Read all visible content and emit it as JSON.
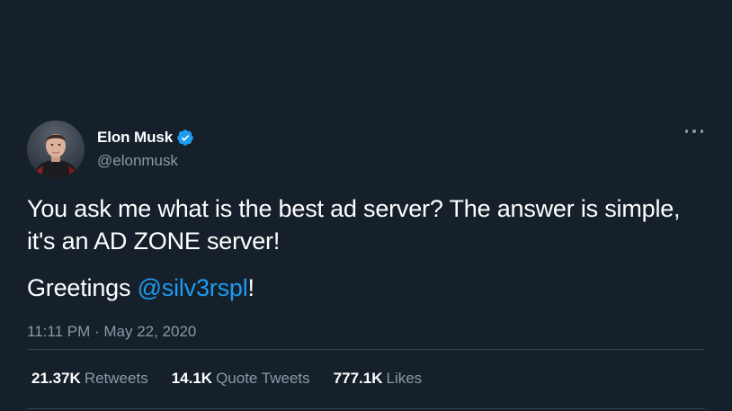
{
  "author": {
    "display_name": "Elon Musk",
    "handle": "@elonmusk",
    "verified": true,
    "avatar_icon": "profile-photo"
  },
  "tweet": {
    "text": "You ask me what is the best ad server? The answer is simple, it's an AD ZONE server!",
    "greeting_prefix": "Greetings ",
    "mention": "@silv3rspl",
    "greeting_suffix": "!",
    "timestamp": "11:11 PM · May 22, 2020"
  },
  "stats": [
    {
      "value": "21.37K",
      "label": "Retweets"
    },
    {
      "value": "14.1K",
      "label": "Quote Tweets"
    },
    {
      "value": "777.1K",
      "label": "Likes"
    }
  ],
  "colors": {
    "background": "#15202b",
    "accent": "#1d9bf0",
    "secondary_text": "#8b98a5",
    "divider": "#38444d"
  },
  "icons": {
    "verified": "verified-badge-icon",
    "more": "more-options-icon"
  }
}
